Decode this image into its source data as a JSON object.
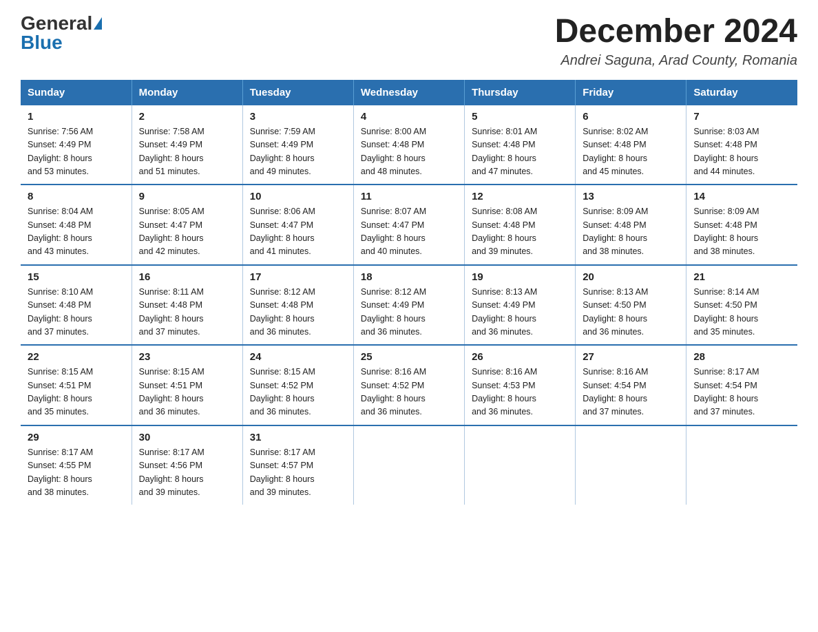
{
  "logo": {
    "general": "General",
    "blue": "Blue"
  },
  "title": "December 2024",
  "subtitle": "Andrei Saguna, Arad County, Romania",
  "days_of_week": [
    "Sunday",
    "Monday",
    "Tuesday",
    "Wednesday",
    "Thursday",
    "Friday",
    "Saturday"
  ],
  "weeks": [
    [
      {
        "day": "1",
        "info": "Sunrise: 7:56 AM\nSunset: 4:49 PM\nDaylight: 8 hours\nand 53 minutes."
      },
      {
        "day": "2",
        "info": "Sunrise: 7:58 AM\nSunset: 4:49 PM\nDaylight: 8 hours\nand 51 minutes."
      },
      {
        "day": "3",
        "info": "Sunrise: 7:59 AM\nSunset: 4:49 PM\nDaylight: 8 hours\nand 49 minutes."
      },
      {
        "day": "4",
        "info": "Sunrise: 8:00 AM\nSunset: 4:48 PM\nDaylight: 8 hours\nand 48 minutes."
      },
      {
        "day": "5",
        "info": "Sunrise: 8:01 AM\nSunset: 4:48 PM\nDaylight: 8 hours\nand 47 minutes."
      },
      {
        "day": "6",
        "info": "Sunrise: 8:02 AM\nSunset: 4:48 PM\nDaylight: 8 hours\nand 45 minutes."
      },
      {
        "day": "7",
        "info": "Sunrise: 8:03 AM\nSunset: 4:48 PM\nDaylight: 8 hours\nand 44 minutes."
      }
    ],
    [
      {
        "day": "8",
        "info": "Sunrise: 8:04 AM\nSunset: 4:48 PM\nDaylight: 8 hours\nand 43 minutes."
      },
      {
        "day": "9",
        "info": "Sunrise: 8:05 AM\nSunset: 4:47 PM\nDaylight: 8 hours\nand 42 minutes."
      },
      {
        "day": "10",
        "info": "Sunrise: 8:06 AM\nSunset: 4:47 PM\nDaylight: 8 hours\nand 41 minutes."
      },
      {
        "day": "11",
        "info": "Sunrise: 8:07 AM\nSunset: 4:47 PM\nDaylight: 8 hours\nand 40 minutes."
      },
      {
        "day": "12",
        "info": "Sunrise: 8:08 AM\nSunset: 4:48 PM\nDaylight: 8 hours\nand 39 minutes."
      },
      {
        "day": "13",
        "info": "Sunrise: 8:09 AM\nSunset: 4:48 PM\nDaylight: 8 hours\nand 38 minutes."
      },
      {
        "day": "14",
        "info": "Sunrise: 8:09 AM\nSunset: 4:48 PM\nDaylight: 8 hours\nand 38 minutes."
      }
    ],
    [
      {
        "day": "15",
        "info": "Sunrise: 8:10 AM\nSunset: 4:48 PM\nDaylight: 8 hours\nand 37 minutes."
      },
      {
        "day": "16",
        "info": "Sunrise: 8:11 AM\nSunset: 4:48 PM\nDaylight: 8 hours\nand 37 minutes."
      },
      {
        "day": "17",
        "info": "Sunrise: 8:12 AM\nSunset: 4:48 PM\nDaylight: 8 hours\nand 36 minutes."
      },
      {
        "day": "18",
        "info": "Sunrise: 8:12 AM\nSunset: 4:49 PM\nDaylight: 8 hours\nand 36 minutes."
      },
      {
        "day": "19",
        "info": "Sunrise: 8:13 AM\nSunset: 4:49 PM\nDaylight: 8 hours\nand 36 minutes."
      },
      {
        "day": "20",
        "info": "Sunrise: 8:13 AM\nSunset: 4:50 PM\nDaylight: 8 hours\nand 36 minutes."
      },
      {
        "day": "21",
        "info": "Sunrise: 8:14 AM\nSunset: 4:50 PM\nDaylight: 8 hours\nand 35 minutes."
      }
    ],
    [
      {
        "day": "22",
        "info": "Sunrise: 8:15 AM\nSunset: 4:51 PM\nDaylight: 8 hours\nand 35 minutes."
      },
      {
        "day": "23",
        "info": "Sunrise: 8:15 AM\nSunset: 4:51 PM\nDaylight: 8 hours\nand 36 minutes."
      },
      {
        "day": "24",
        "info": "Sunrise: 8:15 AM\nSunset: 4:52 PM\nDaylight: 8 hours\nand 36 minutes."
      },
      {
        "day": "25",
        "info": "Sunrise: 8:16 AM\nSunset: 4:52 PM\nDaylight: 8 hours\nand 36 minutes."
      },
      {
        "day": "26",
        "info": "Sunrise: 8:16 AM\nSunset: 4:53 PM\nDaylight: 8 hours\nand 36 minutes."
      },
      {
        "day": "27",
        "info": "Sunrise: 8:16 AM\nSunset: 4:54 PM\nDaylight: 8 hours\nand 37 minutes."
      },
      {
        "day": "28",
        "info": "Sunrise: 8:17 AM\nSunset: 4:54 PM\nDaylight: 8 hours\nand 37 minutes."
      }
    ],
    [
      {
        "day": "29",
        "info": "Sunrise: 8:17 AM\nSunset: 4:55 PM\nDaylight: 8 hours\nand 38 minutes."
      },
      {
        "day": "30",
        "info": "Sunrise: 8:17 AM\nSunset: 4:56 PM\nDaylight: 8 hours\nand 39 minutes."
      },
      {
        "day": "31",
        "info": "Sunrise: 8:17 AM\nSunset: 4:57 PM\nDaylight: 8 hours\nand 39 minutes."
      },
      {
        "day": "",
        "info": ""
      },
      {
        "day": "",
        "info": ""
      },
      {
        "day": "",
        "info": ""
      },
      {
        "day": "",
        "info": ""
      }
    ]
  ]
}
